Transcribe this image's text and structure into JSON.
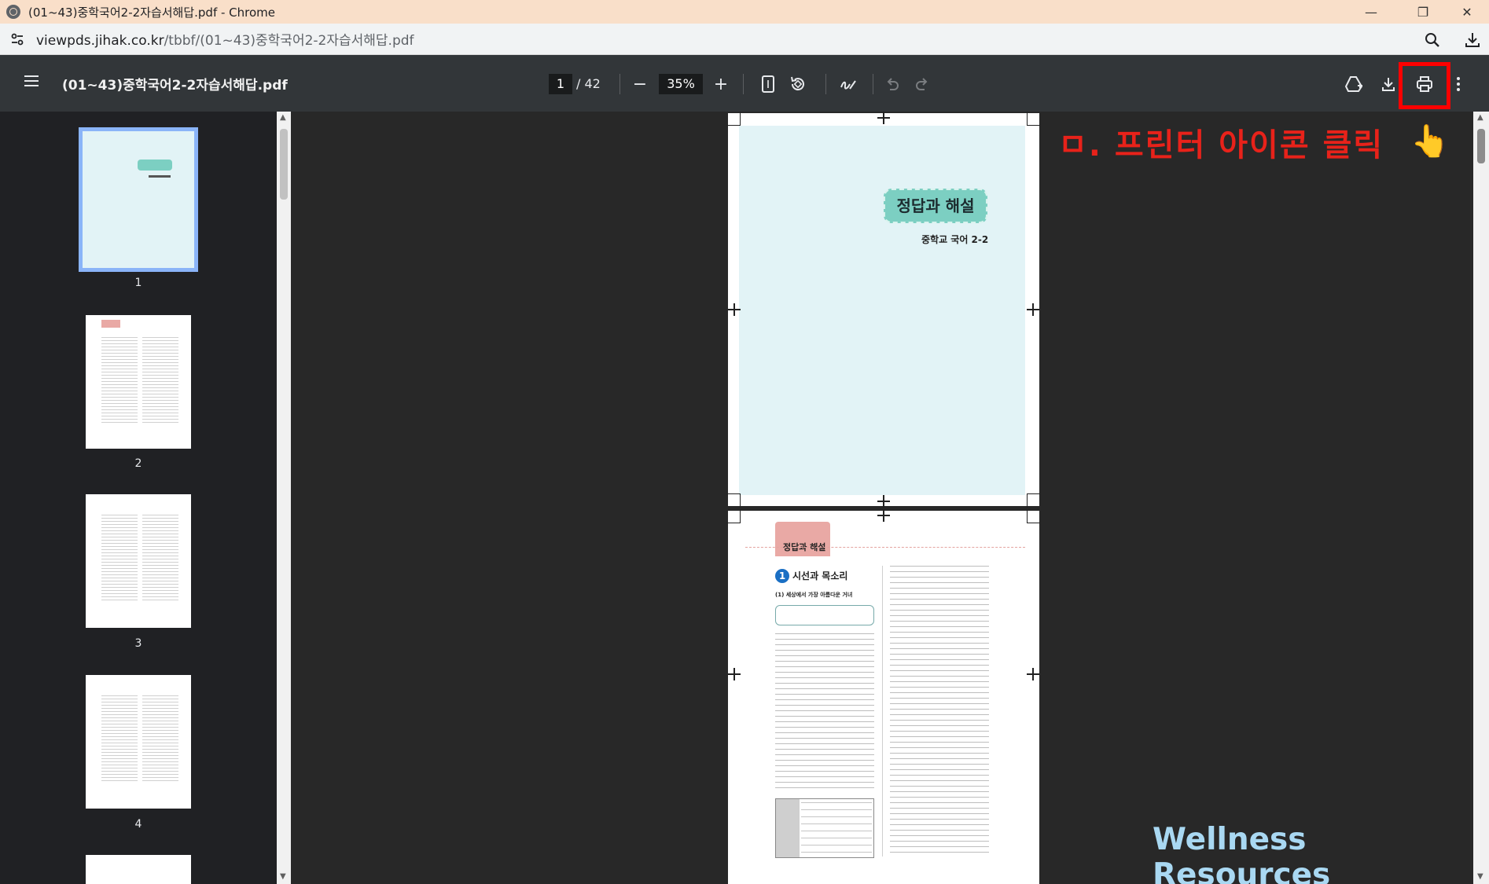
{
  "window": {
    "title": "(01~43)중학국어2-2자습서해답.pdf - Chrome",
    "controls": {
      "minimize": "—",
      "restore": "❐",
      "close": "✕"
    }
  },
  "address_bar": {
    "host": "viewpds.jihak.co.kr",
    "path": "/tbbf/(01~43)중학국어2-2자습서해답.pdf",
    "icons": [
      "site-settings-icon",
      "zoom-icon",
      "download-icon"
    ]
  },
  "pdf_toolbar": {
    "document_title": "(01~43)중학국어2-2자습서해답.pdf",
    "current_page": "1",
    "total_pages": "/ 42",
    "zoom": "35%",
    "zoom_out": "−",
    "zoom_in": "+",
    "icons": [
      "menu-icon",
      "fit-page-icon",
      "rotate-icon",
      "annotate-icon",
      "undo-icon",
      "redo-icon",
      "drive-icon",
      "download-icon",
      "print-icon",
      "more-options-icon"
    ]
  },
  "sidebar": {
    "thumbnails": [
      {
        "label": "1",
        "selected": true
      },
      {
        "label": "2",
        "selected": false
      },
      {
        "label": "3",
        "selected": false
      },
      {
        "label": "4",
        "selected": false
      }
    ]
  },
  "pages": {
    "page1": {
      "title": "정답과 해설",
      "subtitle": "중학교 국어 2-2"
    },
    "page2": {
      "tab": "정답과 해설",
      "section_number": "1",
      "section_title": "시선과 목소리",
      "subsection": "(1) 세상에서 가장 아름다운 거녀"
    }
  },
  "annotation": {
    "text": "ㅁ. 프린터 아이콘 클릭",
    "highlight_color": "#ff0000",
    "hand": "👆"
  },
  "watermark": "Wellness Resources"
}
